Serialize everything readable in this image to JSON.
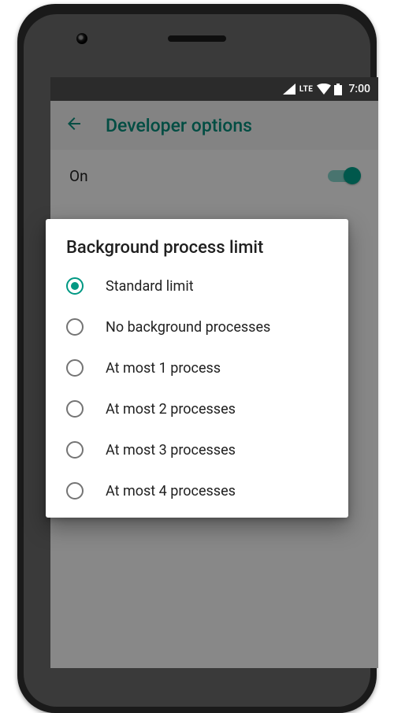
{
  "status": {
    "network": "LTE",
    "time": "7:00"
  },
  "appbar": {
    "title": "Developer options"
  },
  "toggle": {
    "label": "On"
  },
  "dialog": {
    "title": "Background process limit",
    "options": [
      {
        "label": "Standard limit",
        "selected": true
      },
      {
        "label": "No background processes",
        "selected": false
      },
      {
        "label": "At most 1 process",
        "selected": false
      },
      {
        "label": "At most 2 processes",
        "selected": false
      },
      {
        "label": "At most 3 processes",
        "selected": false
      },
      {
        "label": "At most 4 processes",
        "selected": false
      }
    ]
  }
}
